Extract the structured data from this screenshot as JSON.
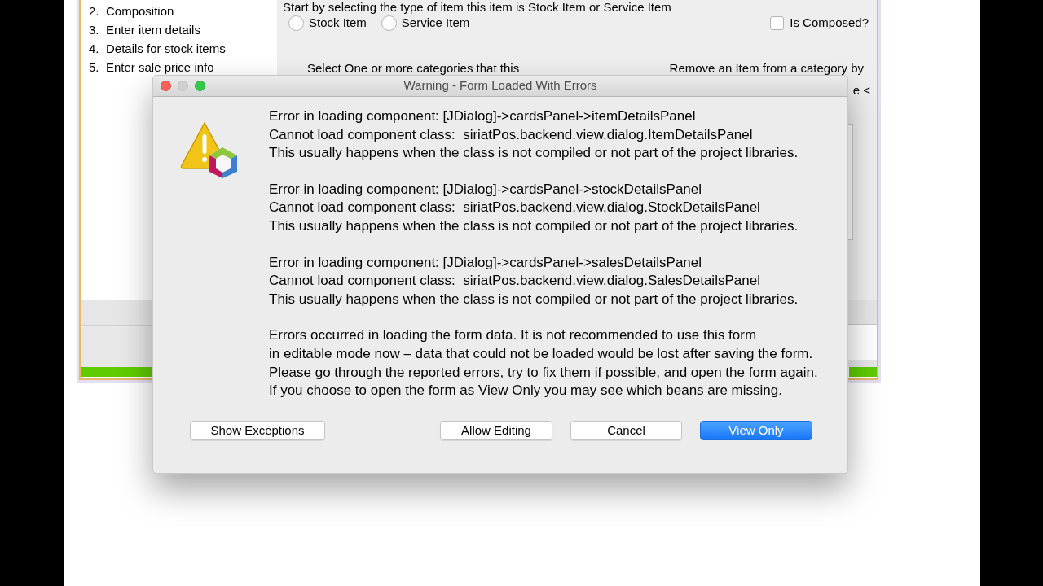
{
  "background_window": {
    "steps": [
      {
        "number": "2.",
        "label": "Composition"
      },
      {
        "number": "3.",
        "label": "Enter item details"
      },
      {
        "number": "4.",
        "label": "Details for stock items"
      },
      {
        "number": "5.",
        "label": "Enter sale price info"
      }
    ],
    "instruction": "Start by selecting the type of item this item is Stock Item or Service Item",
    "item_types": [
      {
        "label": "Stock Item",
        "selected": false
      },
      {
        "label": "Service Item",
        "selected": false
      }
    ],
    "is_composed": {
      "label": "Is Composed?",
      "checked": false
    },
    "categories_hint": "Select One or more categories that this",
    "remove_hint": "Remove an Item from a category by",
    "remove_hint_end": "e <",
    "progress": {
      "level": 1
    }
  },
  "dialog": {
    "title": "Warning - Form Loaded With Errors",
    "paragraphs": [
      [
        "Error in loading component: [JDialog]->cardsPanel->itemDetailsPanel",
        "Cannot load component class:  siriatPos.backend.view.dialog.ItemDetailsPanel",
        "This usually happens when the class is not compiled or not part of the project libraries."
      ],
      [
        "Error in loading component: [JDialog]->cardsPanel->stockDetailsPanel",
        "Cannot load component class:  siriatPos.backend.view.dialog.StockDetailsPanel",
        "This usually happens when the class is not compiled or not part of the project libraries."
      ],
      [
        "Error in loading component: [JDialog]->cardsPanel->salesDetailsPanel",
        "Cannot load component class:  siriatPos.backend.view.dialog.SalesDetailsPanel",
        "This usually happens when the class is not compiled or not part of the project libraries."
      ],
      [
        "Errors occurred in loading the form data. It is not recommended to use this form",
        "in editable mode now – data that could not be loaded would be lost after saving the form.",
        "Please go through the reported errors, try to fix them if possible, and open the form again.",
        "If you choose to open the form as View Only you may see which beans are missing."
      ]
    ],
    "left_button": {
      "label": "Show Exceptions",
      "default": false
    },
    "buttons": [
      {
        "label": "Allow Editing",
        "default": false
      },
      {
        "label": "Cancel",
        "default": false
      },
      {
        "label": "View Only",
        "default": true
      }
    ]
  }
}
